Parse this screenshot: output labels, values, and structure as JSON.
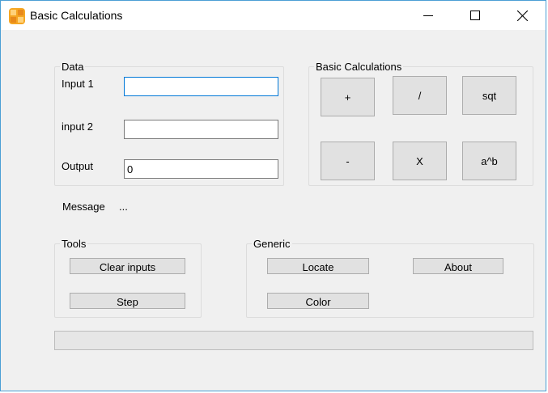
{
  "window": {
    "title": "Basic Calculations",
    "icon": "app-calculator-icon",
    "controls": {
      "minimize": "minimize-icon",
      "maximize": "maximize-icon",
      "close": "close-icon"
    }
  },
  "data_group": {
    "legend": "Data",
    "input1_label": "Input 1",
    "input1_value": "",
    "input2_label": "input 2",
    "input2_value": "",
    "output_label": "Output",
    "output_value": "0"
  },
  "calc_group": {
    "legend": "Basic Calculations",
    "buttons": {
      "add": "+",
      "divide": "/",
      "sqrt": "sqt",
      "subtract": "-",
      "multiply": "X",
      "power": "a^b"
    }
  },
  "message": {
    "label": "Message",
    "value": "..."
  },
  "tools_group": {
    "legend": "Tools",
    "clear": "Clear inputs",
    "step": "Step"
  },
  "generic_group": {
    "legend": "Generic",
    "locate": "Locate",
    "about": "About",
    "color": "Color"
  },
  "progress": {
    "value": 0
  },
  "colors": {
    "accent": "#0078d7",
    "window_border": "#4b9fd5",
    "button_face": "#e1e1e1",
    "background": "#f0f0f0"
  }
}
